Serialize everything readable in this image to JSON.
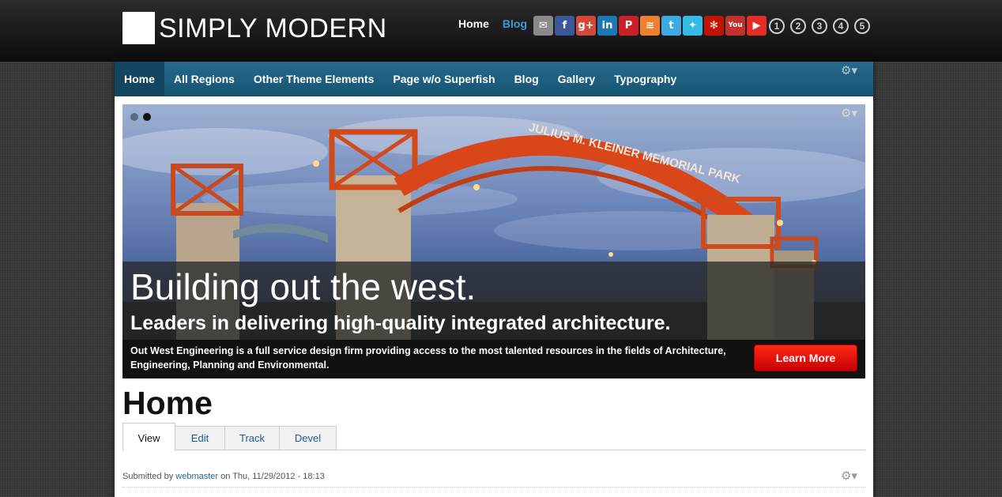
{
  "header": {
    "logo_text": "SIMPLY MODERN",
    "links": [
      {
        "label": "Home",
        "color": "#ffffff"
      },
      {
        "label": "Blog",
        "color": "#3a9bd5"
      }
    ],
    "social_icons": [
      {
        "name": "email-icon",
        "glyph": "✉",
        "bg": "#8a8a8a"
      },
      {
        "name": "facebook-icon",
        "glyph": "f",
        "bg": "#3b5998"
      },
      {
        "name": "googleplus-icon",
        "glyph": "g+",
        "bg": "#d34836"
      },
      {
        "name": "linkedin-icon",
        "glyph": "in",
        "bg": "#1e78b4"
      },
      {
        "name": "pinterest-icon",
        "glyph": "P",
        "bg": "#cb2027"
      },
      {
        "name": "rss-icon",
        "glyph": "≋",
        "bg": "#ee802f"
      },
      {
        "name": "tumblr-icon",
        "glyph": "t",
        "bg": "#3ca9e0"
      },
      {
        "name": "twitter-icon",
        "glyph": "✦",
        "bg": "#33bbe6"
      },
      {
        "name": "yelp-icon",
        "glyph": "✻",
        "bg": "#c41200"
      },
      {
        "name": "youtube-icon",
        "glyph": "You",
        "bg": "#c4302b"
      },
      {
        "name": "youtube-play-icon",
        "glyph": "▶",
        "bg": "#e52d27"
      }
    ],
    "numbers": [
      "1",
      "2",
      "3",
      "4",
      "5"
    ]
  },
  "nav": {
    "items": [
      "Home",
      "All Regions",
      "Other Theme Elements",
      "Page w/o Superfish",
      "Blog",
      "Gallery",
      "Typography"
    ],
    "active_index": 0,
    "gear_glyph": "⚙▾"
  },
  "slider": {
    "gear_glyph": "⚙▾",
    "dot_colors": [
      "#5a6a80",
      "#111111"
    ],
    "title": "Building out the west.",
    "subtitle": "Leaders in delivering high-quality integrated architecture.",
    "description": "Out West Engineering is a full service design firm providing access to the most talented resources in the fields of Architecture, Engineering, Planning and Environmental.",
    "button_label": "Learn More",
    "arch_text": "JULIUS M. KLEINER MEMORIAL PARK"
  },
  "content": {
    "title": "Home",
    "tabs": [
      "View",
      "Edit",
      "Track",
      "Devel"
    ],
    "active_tab": 0,
    "submitted_prefix": "Submitted by",
    "author": "webmaster",
    "submitted_suffix": "on Thu, 11/29/2012 - 18:13",
    "gear_glyph": "⚙▾"
  }
}
